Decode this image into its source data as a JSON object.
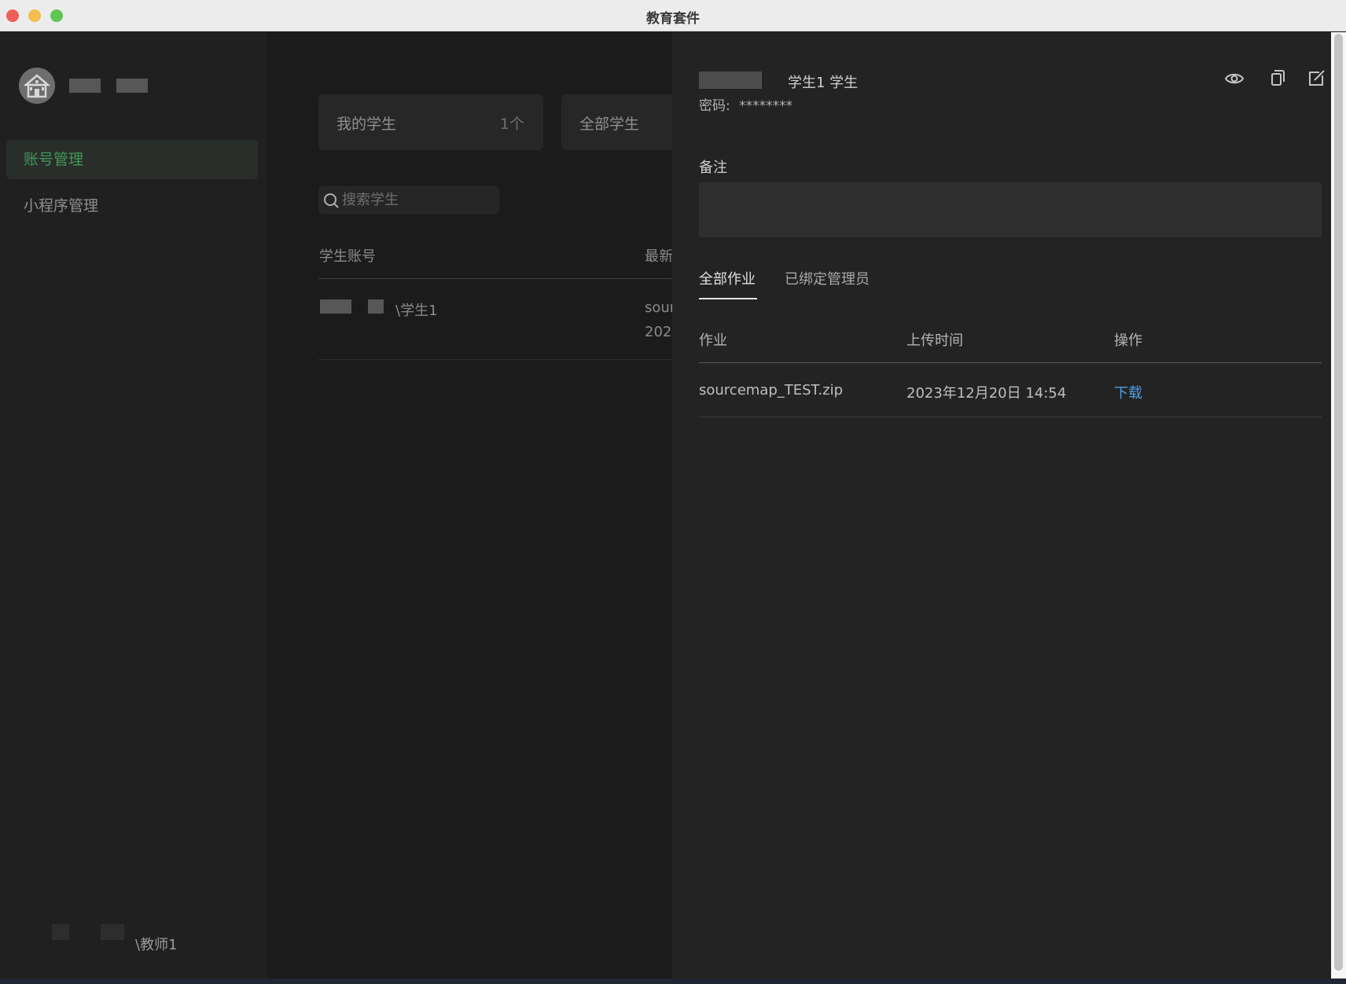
{
  "window": {
    "title": "教育套件"
  },
  "sidebar": {
    "menu": [
      {
        "label": "账号管理",
        "active": true
      },
      {
        "label": "小程序管理",
        "active": false
      }
    ],
    "footer_user": "\\教师1"
  },
  "main": {
    "stats": {
      "mine_label": "我的学生",
      "mine_count": "1个",
      "all_label": "全部学生"
    },
    "search": {
      "placeholder": "搜索学生"
    },
    "table": {
      "headers": [
        "学生账号",
        "最新"
      ],
      "rows": [
        {
          "account": "\\学生1",
          "latest_line1": "sour",
          "latest_line2": "202"
        }
      ]
    }
  },
  "drawer": {
    "student_name": "学生1  学生",
    "password_label": "密码:",
    "password_value": "********",
    "remark_label": "备注",
    "remark_value": "",
    "tabs": [
      {
        "label": "全部作业",
        "active": true
      },
      {
        "label": "已绑定管理员",
        "active": false
      }
    ],
    "table": {
      "headers": [
        "作业",
        "上传时间",
        "操作"
      ],
      "rows": [
        {
          "file": "sourcemap_TEST.zip",
          "time": "2023年12月20日 14:54",
          "action": "下载"
        }
      ]
    },
    "icons": [
      "eye-icon",
      "copy-icon",
      "edit-icon"
    ]
  },
  "colors": {
    "accent_green": "#3d9a58",
    "link_blue": "#4d9ee8",
    "drawer_bg": "#232323"
  }
}
